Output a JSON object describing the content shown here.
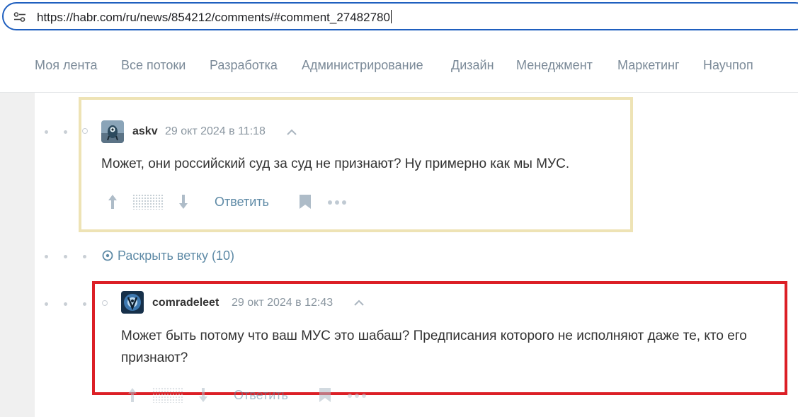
{
  "browser": {
    "url": "https://habr.com/ru/news/854212/comments/#comment_27482780",
    "tune_icon": "site-settings-icon"
  },
  "nav": {
    "items": [
      {
        "label": "Моя лента"
      },
      {
        "label": "Все потоки"
      },
      {
        "label": "Разработка"
      },
      {
        "label": "Администрирование"
      },
      {
        "label": "Дизайн"
      },
      {
        "label": "Менеджмент"
      },
      {
        "label": "Маркетинг"
      },
      {
        "label": "Научпоп"
      }
    ]
  },
  "comments": [
    {
      "username": "askv",
      "time": "29 окт 2024 в 11:18",
      "text": "Может, они российский суд за суд не признают? Ну примерно как мы МУС.",
      "reply_label": "Ответить",
      "highlight_color": "#eee3b5"
    },
    {
      "username": "comradeleet",
      "time": "29 окт 2024 в 12:43",
      "text": "Может быть потому что ваш МУС это шабаш? Предписания которого не исполняют даже те, кто его признают?",
      "reply_label": "Ответить",
      "highlight_color": "#dc1f26"
    }
  ],
  "expand_branch": {
    "label": "Раскрыть ветку (10)"
  },
  "colors": {
    "accent": "#5e8aa6",
    "nav_text": "#7b8a98",
    "url_border": "#1f5fbf"
  }
}
